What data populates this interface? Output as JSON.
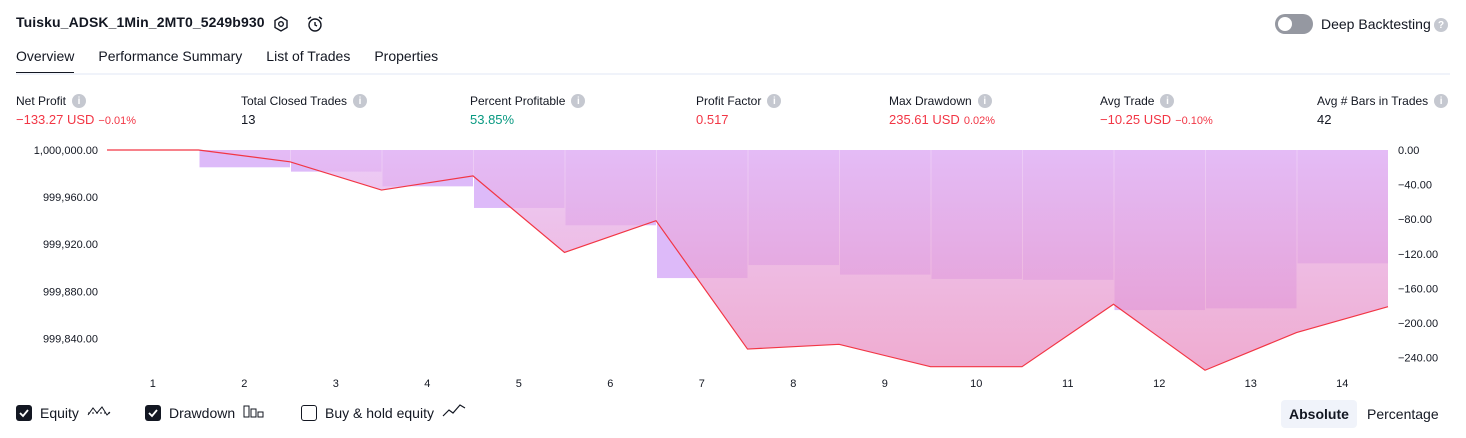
{
  "header": {
    "title": "Tuisku_ADSK_1Min_2MT0_5249b930",
    "deep_backtesting_label": "Deep Backtesting",
    "deep_backtesting_enabled": false
  },
  "tabs": [
    {
      "label": "Overview",
      "active": true
    },
    {
      "label": "Performance Summary",
      "active": false
    },
    {
      "label": "List of Trades",
      "active": false
    },
    {
      "label": "Properties",
      "active": false
    }
  ],
  "metrics": {
    "net_profit": {
      "label": "Net Profit",
      "value": "−133.27 USD",
      "pct": "−0.01%"
    },
    "total_closed_trades": {
      "label": "Total Closed Trades",
      "value": "13"
    },
    "percent_profitable": {
      "label": "Percent Profitable",
      "value": "53.85%"
    },
    "profit_factor": {
      "label": "Profit Factor",
      "value": "0.517"
    },
    "max_drawdown": {
      "label": "Max Drawdown",
      "value": "235.61 USD",
      "pct": "0.02%"
    },
    "avg_trade": {
      "label": "Avg Trade",
      "value": "−10.25 USD",
      "pct": "−0.10%"
    },
    "avg_bars": {
      "label": "Avg # Bars in Trades",
      "value": "42"
    }
  },
  "chart_data": {
    "type": "line",
    "x": [
      1,
      2,
      3,
      4,
      5,
      6,
      7,
      8,
      9,
      10,
      11,
      12,
      13,
      14
    ],
    "x_tick_labels": [
      "1",
      "2",
      "3",
      "4",
      "5",
      "6",
      "7",
      "8",
      "9",
      "10",
      "11",
      "12",
      "13",
      "14"
    ],
    "series": [
      {
        "name": "Equity",
        "color": "#f23645",
        "x": [
          0,
          1,
          2,
          3,
          4,
          5,
          6,
          7,
          8,
          9,
          10,
          11,
          12,
          13,
          14
        ],
        "values": [
          1000000.0,
          1000000.0,
          999990.0,
          999966.0,
          999978.0,
          999913.0,
          999940.0,
          999831.0,
          999835.0,
          999816.0,
          999816.0,
          999869.0,
          999813.0,
          999845.0,
          999867.0
        ]
      },
      {
        "name": "Drawdown",
        "color": "#d7aef8",
        "x": [
          1,
          2,
          3,
          4,
          5,
          6,
          7,
          8,
          9,
          10,
          11,
          12,
          13,
          14
        ],
        "values": [
          0,
          -20,
          -25,
          -42,
          -67,
          -87,
          -148,
          -133,
          -144,
          -149,
          -150,
          -185,
          -183,
          -131
        ]
      }
    ],
    "left_axis": {
      "ylim": [
        999820,
        1000000
      ],
      "ticks": [
        "1,000,000.00",
        "999,960.00",
        "999,920.00",
        "999,880.00",
        "999,840.00"
      ],
      "tick_values": [
        1000000,
        999960,
        999920,
        999880,
        999840
      ]
    },
    "right_axis": {
      "ylim": [
        -245,
        0
      ],
      "ticks": [
        "0.00",
        "−40.00",
        "−80.00",
        "−120.00",
        "−160.00",
        "−200.00",
        "−240.00"
      ],
      "tick_values": [
        0,
        -40,
        -80,
        -120,
        -160,
        -200,
        -240
      ]
    }
  },
  "legend": {
    "equity": {
      "label": "Equity",
      "checked": true
    },
    "drawdown": {
      "label": "Drawdown",
      "checked": true
    },
    "buy_hold": {
      "label": "Buy & hold equity",
      "checked": false
    }
  },
  "view_mode": {
    "absolute_label": "Absolute",
    "percentage_label": "Percentage",
    "selected": "Absolute"
  },
  "colors": {
    "profit": "#089981",
    "loss": "#f23645",
    "drawdown_bar": "#d7aef8"
  }
}
